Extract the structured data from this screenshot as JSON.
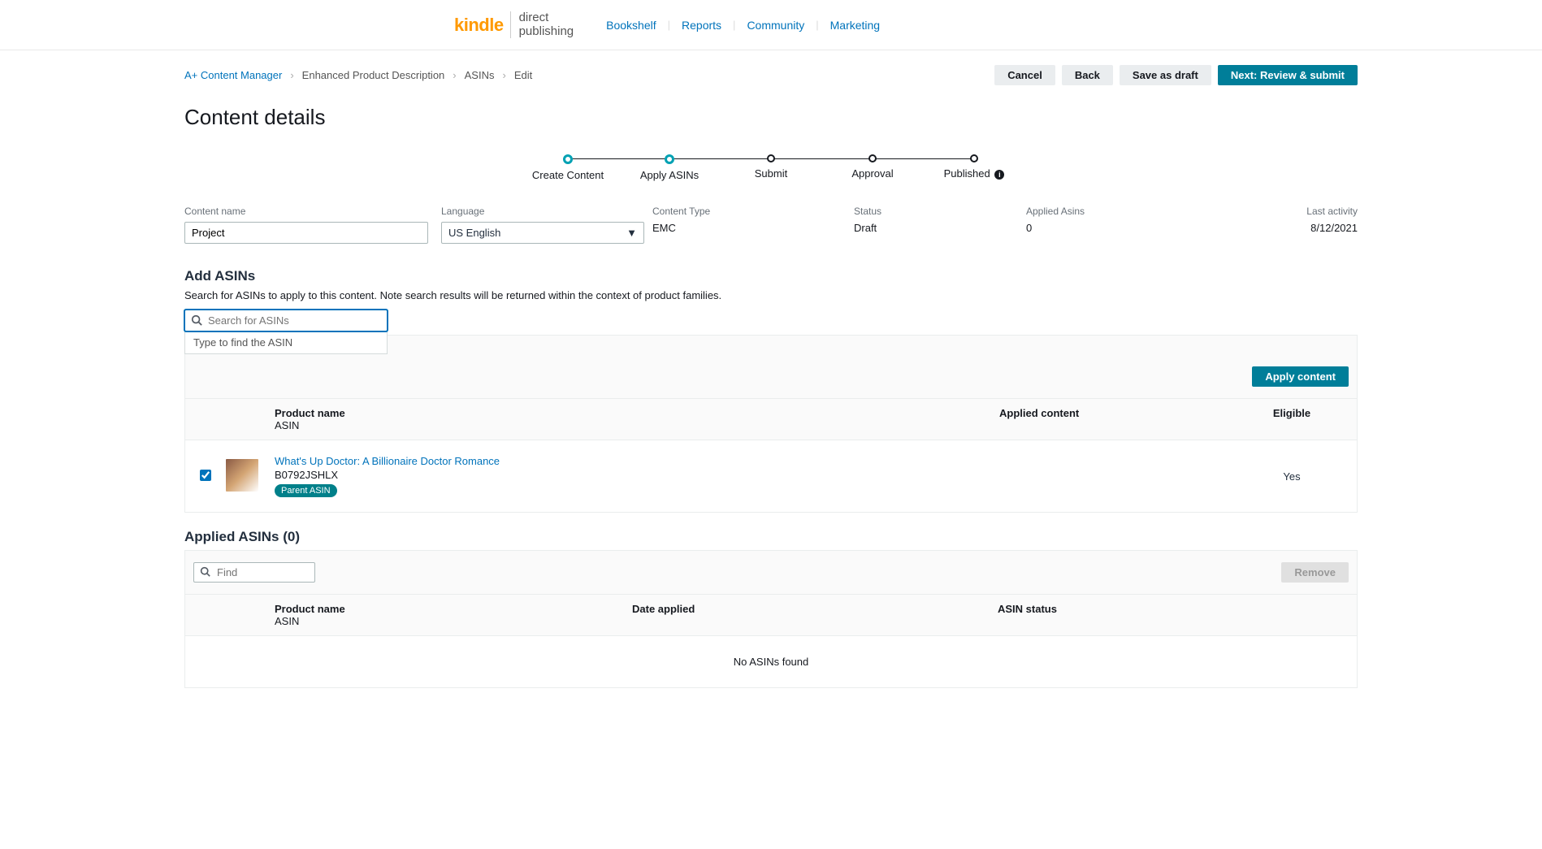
{
  "header": {
    "logo_kindle": "kindle",
    "logo_direct": "direct",
    "logo_publishing": "publishing",
    "nav": {
      "bookshelf": "Bookshelf",
      "reports": "Reports",
      "community": "Community",
      "marketing": "Marketing"
    }
  },
  "breadcrumb": {
    "root": "A+ Content Manager",
    "epd": "Enhanced Product Description",
    "asins": "ASINs",
    "edit": "Edit"
  },
  "actions": {
    "cancel": "Cancel",
    "back": "Back",
    "save_draft": "Save as draft",
    "next": "Next: Review & submit"
  },
  "page_title": "Content details",
  "stepper": {
    "create": "Create Content",
    "apply": "Apply ASINs",
    "submit": "Submit",
    "approval": "Approval",
    "published": "Published"
  },
  "details": {
    "content_name_label": "Content name",
    "content_name_value": "Project",
    "language_label": "Language",
    "language_value": "US English",
    "content_type_label": "Content Type",
    "content_type_value": "EMC",
    "status_label": "Status",
    "status_value": "Draft",
    "applied_asins_label": "Applied Asins",
    "applied_asins_value": "0",
    "last_activity_label": "Last activity",
    "last_activity_value": "8/12/2021"
  },
  "add_asins": {
    "title": "Add ASINs",
    "desc": "Search for ASINs to apply to this content. Note search results will be returned within the context of product families.",
    "search_placeholder": "Search for ASINs",
    "dropdown_hint": "Type to find the ASIN",
    "apply_button": "Apply content",
    "columns": {
      "product_name": "Product name",
      "asin": "ASIN",
      "applied_content": "Applied content",
      "eligible": "Eligible"
    },
    "rows": [
      {
        "title": "What's Up Doctor: A Billionaire Doctor Romance",
        "asin": "B0792JSHLX",
        "badge": "Parent ASIN",
        "eligible": "Yes",
        "checked": true
      }
    ]
  },
  "applied_asins": {
    "title": "Applied ASINs (0)",
    "find_placeholder": "Find",
    "remove_button": "Remove",
    "columns": {
      "product_name": "Product name",
      "asin": "ASIN",
      "date_applied": "Date applied",
      "asin_status": "ASIN status"
    },
    "empty": "No ASINs found"
  }
}
